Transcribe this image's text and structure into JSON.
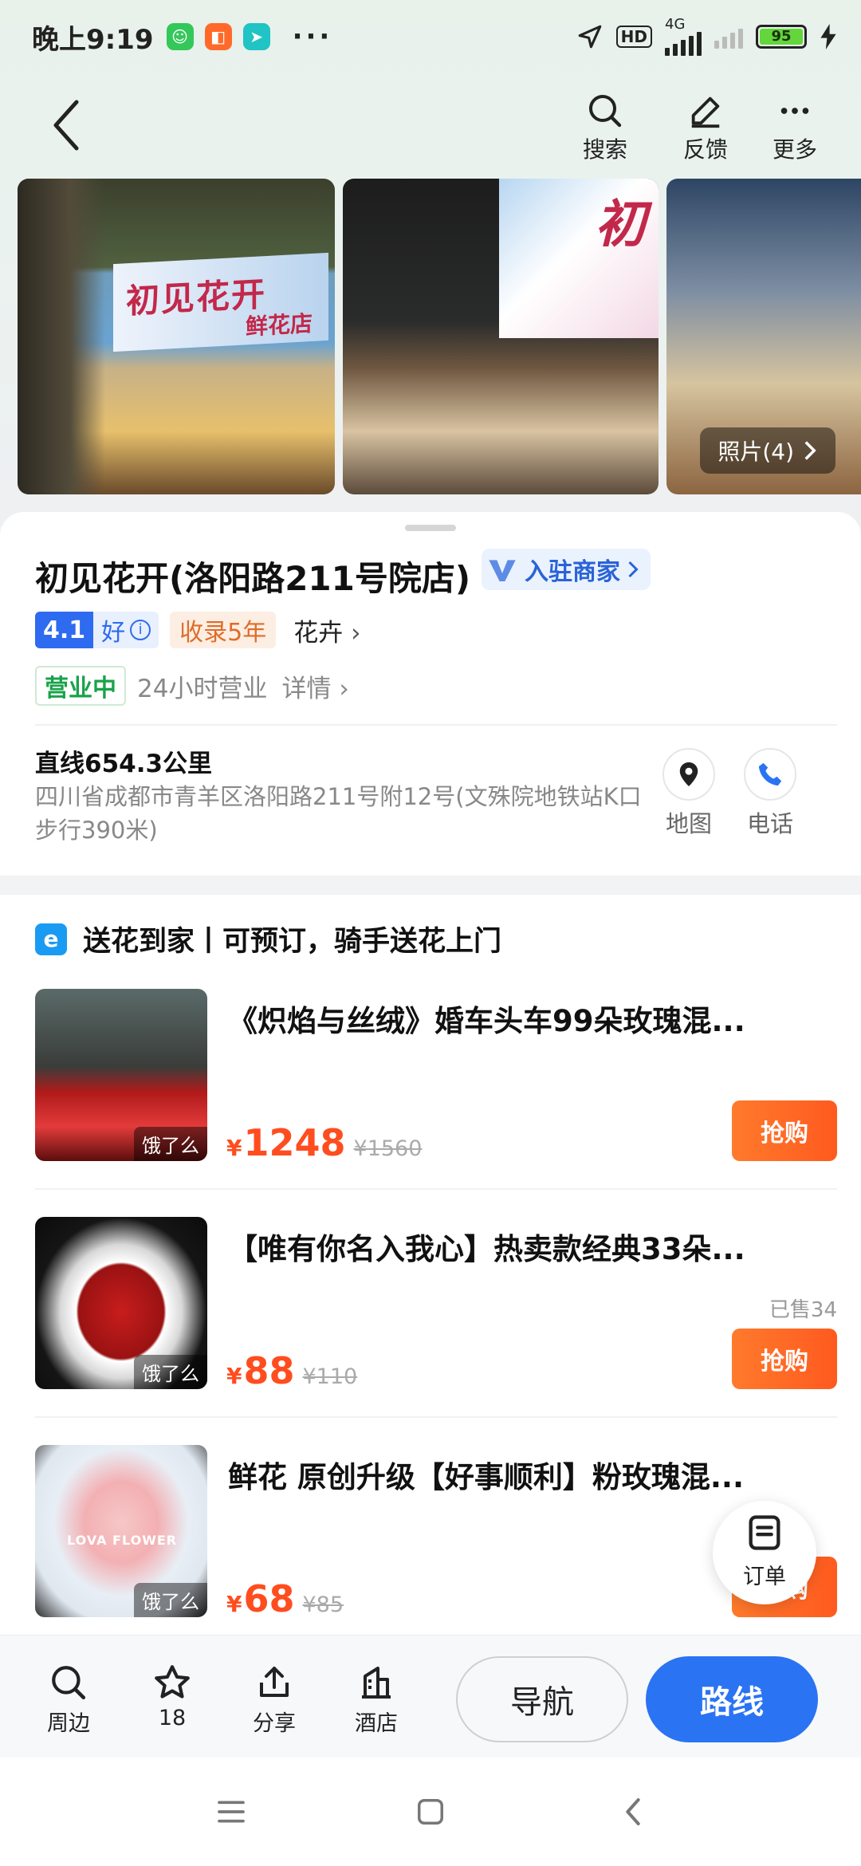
{
  "status_bar": {
    "time": "晚上9:19",
    "network": "4G",
    "hd": "HD",
    "battery": "95",
    "more": "···"
  },
  "header": {
    "actions": [
      {
        "label": "搜索"
      },
      {
        "label": "反馈"
      },
      {
        "label": "更多"
      }
    ]
  },
  "photos": {
    "sign_main": "初见花开",
    "sign_sub": "鲜花店",
    "sign_second": "初",
    "count_label": "照片(4)"
  },
  "shop": {
    "name": "初见花开(洛阳路211号院店)",
    "merchant_badge": "入驻商家",
    "rating": "4.1",
    "rating_level": "好",
    "listed": "收录5年",
    "category": "花卉",
    "status": "营业中",
    "hours": "24小时营业",
    "details": "详情",
    "distance": "直线654.3公里",
    "address": "四川省成都市青羊区洛阳路211号附12号(文殊院地铁站K口步行390米)",
    "map_label": "地图",
    "phone_label": "电话"
  },
  "delivery": {
    "header": "送花到家丨可预订，骑手送花上门",
    "products": [
      {
        "name": "《炽焰与丝绒》婚车头车99朵玫瑰混...",
        "price": "1248",
        "original": "¥1560",
        "sold": "",
        "platform": "饿了么",
        "buy": "抢购"
      },
      {
        "name": "【唯有你名入我心】热卖款经典33朵...",
        "price": "88",
        "original": "¥110",
        "sold": "已售34",
        "platform": "饿了么",
        "buy": "抢购"
      },
      {
        "name": "鲜花 原创升级【好事顺利】粉玫瑰混...",
        "price": "68",
        "original": "¥85",
        "sold": "",
        "platform": "饿了么",
        "buy": "抢购"
      }
    ],
    "currency": "¥",
    "thumb_text": "LOVA FLOWER"
  },
  "order_fab": {
    "label": "订单"
  },
  "bottom_bar": {
    "nearby": "周边",
    "favorite_count": "18",
    "share": "分享",
    "hotel": "酒店",
    "navigate": "导航",
    "route": "路线"
  },
  "colors": {
    "accent": "#2a73f3",
    "price": "#ff4d1f",
    "open": "#18a34a",
    "rating": "#2f6bf0"
  }
}
